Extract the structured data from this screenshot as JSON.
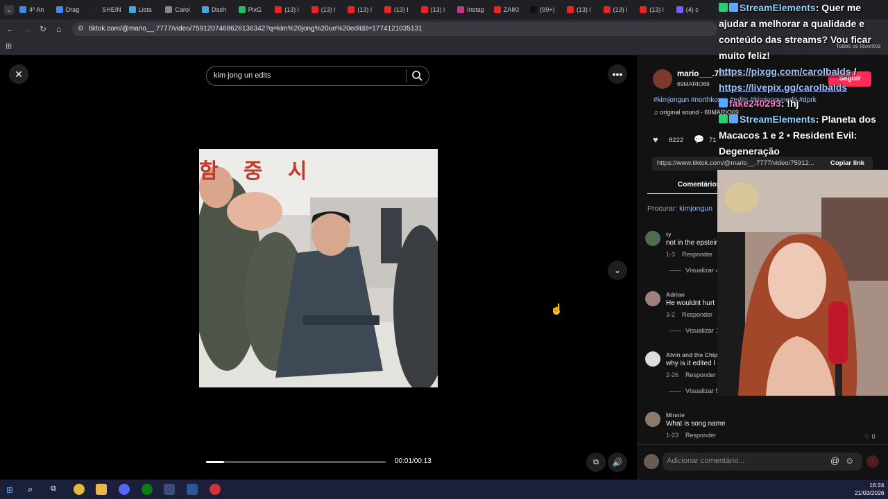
{
  "browser": {
    "tabs": [
      "4º An",
      "Drag",
      "SHEIN",
      "Lista",
      "Carol",
      "Dash",
      "PixG",
      "(13) l",
      "(13) l",
      "(13) l",
      "(13) l",
      "(13) l",
      "Instag",
      "ZAIKI",
      "(99+)",
      "(13) l",
      "(13) l",
      "(13) l",
      "(4) c"
    ],
    "url": "tiktok.com/@mario__.7777/video/7591207468626136342?q=kim%20jong%20ue%20edit&t=1774121035131",
    "bookmarks_right": "Todos os favoritos"
  },
  "search": {
    "query": "kim jong un edits"
  },
  "video": {
    "time": "00:01/00:13",
    "progress": 0.1,
    "banner_text": "함 중 시"
  },
  "post": {
    "username": "mario___.7777",
    "nickname": "69MARIO69",
    "follow_label": "Seguir",
    "caption": "#kimjongun #northkorea #edits #kimjongunedit #dprk",
    "sound": "original sound - 69MARIO69",
    "likes": "8222",
    "comments_count": "71",
    "link": "https://www.tiktok.com/@mario__.7777/video/75912...",
    "copy_link_label": "Copiar link"
  },
  "comments_tab": "Comentários",
  "search_hint_label": "Procurar:",
  "search_hint_value": "kimjongun",
  "comments": [
    {
      "user": "ty",
      "text": "not in the epstein",
      "date": "1-3",
      "reply": "Responder",
      "view": "Visualizar 4"
    },
    {
      "user": "Adrian",
      "text": "He wouldnt hurt",
      "date": "3-2",
      "reply": "Responder",
      "view": "Visualizar 1"
    },
    {
      "user": "Alvin and the Chip",
      "text": "why is it edited l",
      "date": "2-26",
      "reply": "Responder",
      "view": "Visualizar 5"
    },
    {
      "user": "Minnie",
      "text": "What is song name",
      "date": "1-23",
      "reply": "Responder",
      "likes": "0"
    }
  ],
  "comment_input": {
    "placeholder": "Adicionar comentário..."
  },
  "chat": [
    {
      "user": "StreamElements",
      "text": ": Quer me ajudar a melhorar a qualidade e conteúdo das streams? Vou ficar muito feliz!"
    },
    {
      "link1": "https://pixgg.com/carolbalds",
      "sep": " / ",
      "link2": "https://livepix.gg/carolbalds"
    },
    {
      "user": "fake240293",
      "text": ": !hj"
    },
    {
      "user": "StreamElements",
      "text": ": Planeta dos Macacos 1 e 2 • Resident Evil: Degeneração"
    }
  ],
  "taskbar": {
    "time": "16:24",
    "date": "21/03/2026"
  },
  "colors": {
    "follow": "#fe2c55",
    "bg": "#000000",
    "panel": "#121212",
    "taskbar": "#1c1f3a"
  }
}
